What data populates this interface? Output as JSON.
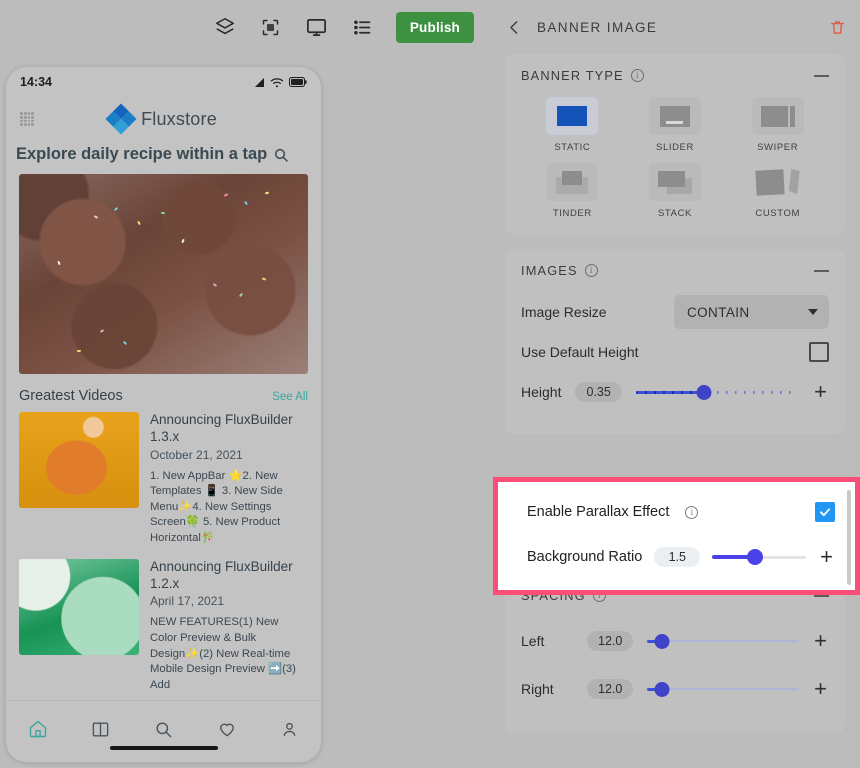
{
  "toolbar": {
    "icons": [
      {
        "name": "layers-icon",
        "label": "Layers"
      },
      {
        "name": "qr-scan-icon",
        "label": "Scan"
      },
      {
        "name": "desktop-preview-icon",
        "label": "Desktop preview"
      },
      {
        "name": "list-view-icon",
        "label": "List view"
      }
    ],
    "publish_label": "Publish",
    "publish_color": "#3f9142"
  },
  "phone": {
    "status": {
      "time": "14:34"
    },
    "app_bar": {
      "brand": "Fluxstore"
    },
    "headline": "Explore daily recipe within a tap",
    "videos": {
      "section_title": "Greatest Videos",
      "see_all": "See All",
      "items": [
        {
          "title": "Announcing FluxBuilder 1.3.x",
          "date": "October 21, 2021",
          "desc": "1. New AppBar ⭐2. New Templates 📱 3. New Side Menu✨4. New Settings Screen🍀 5. New Product Horizontal🎋"
        },
        {
          "title": "Announcing FluxBuilder 1.2.x",
          "date": "April 17, 2021",
          "desc": "NEW FEATURES(1) New Color Preview & Bulk Design✨(2) New Real-time Mobile Design Preview ➡️(3) Add"
        }
      ]
    },
    "bottom_nav": [
      {
        "name": "nav-home-icon",
        "active": true
      },
      {
        "name": "nav-categories-icon",
        "active": false
      },
      {
        "name": "nav-search-icon",
        "active": false
      },
      {
        "name": "nav-wishlist-icon",
        "active": false
      },
      {
        "name": "nav-profile-icon",
        "active": false
      }
    ]
  },
  "inspector": {
    "title": "BANNER IMAGE",
    "back_label": "Back",
    "delete_label": "Delete",
    "delete_color": "#e05a47",
    "banner_type": {
      "title": "BANNER TYPE",
      "options": [
        {
          "label": "STATIC",
          "selected": true
        },
        {
          "label": "SLIDER",
          "selected": false
        },
        {
          "label": "SWIPER",
          "selected": false
        },
        {
          "label": "TINDER",
          "selected": false
        },
        {
          "label": "STACK",
          "selected": false
        },
        {
          "label": "CUSTOM",
          "selected": false
        }
      ]
    },
    "images": {
      "title": "IMAGES",
      "image_resize": {
        "label": "Image Resize",
        "value": "CONTAIN"
      },
      "use_default_height": {
        "label": "Use Default Height",
        "checked": false
      },
      "height": {
        "label": "Height",
        "value": "0.35",
        "percent": 42,
        "plus": "+"
      }
    },
    "parallax": {
      "enable": {
        "label": "Enable Parallax Effect",
        "checked": true
      },
      "background_ratio": {
        "label": "Background Ratio",
        "value": "1.5",
        "percent": 45,
        "plus": "+"
      },
      "highlight_color": "#fa4d77"
    },
    "spacing": {
      "title": "SPACING",
      "rows": [
        {
          "label": "Left",
          "value": "12.0",
          "percent": 10,
          "plus": "+"
        },
        {
          "label": "Right",
          "value": "12.0",
          "percent": 10,
          "plus": "+"
        }
      ]
    }
  }
}
